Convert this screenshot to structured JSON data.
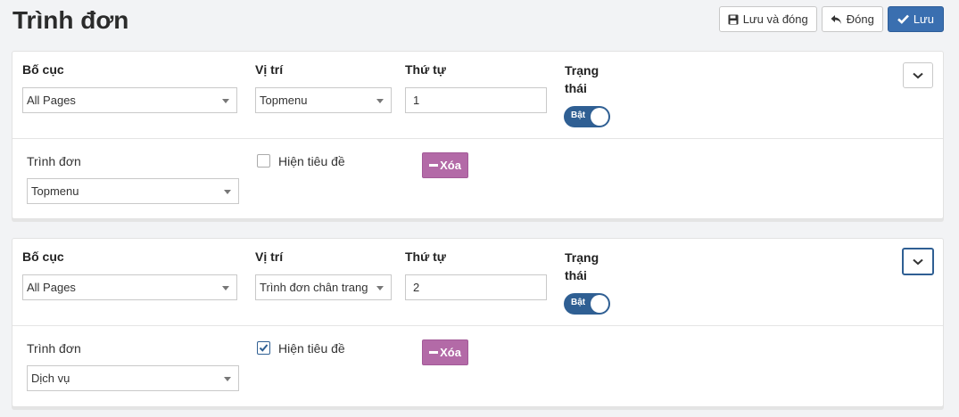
{
  "page": {
    "title": "Trình đơn"
  },
  "toolbar": {
    "save_close_label": "Lưu và đóng",
    "close_label": "Đóng",
    "save_label": "Lưu"
  },
  "labels": {
    "layout": "Bố cục",
    "position": "Vị trí",
    "order": "Thứ tự",
    "status": "Trạng thái",
    "menu": "Trình đơn",
    "show_title": "Hiện tiêu đề",
    "delete": "Xóa"
  },
  "modules": [
    {
      "layout": "All Pages",
      "position": "Topmenu",
      "order": "1",
      "status": "Bật",
      "menu": "Topmenu",
      "show_title": false
    },
    {
      "layout": "All Pages",
      "position": "Trình đơn chân trang",
      "order": "2",
      "status": "Bật",
      "menu": "Dịch vụ",
      "show_title": true
    }
  ],
  "icons": {
    "save": "floppy-icon",
    "close": "undo-arrow-icon",
    "check": "check-icon",
    "collapse": "chevron-down-icon"
  },
  "colors": {
    "primary": "#3a6fb0",
    "toggle": "#2f5f93",
    "delete": "#b36aa7"
  }
}
